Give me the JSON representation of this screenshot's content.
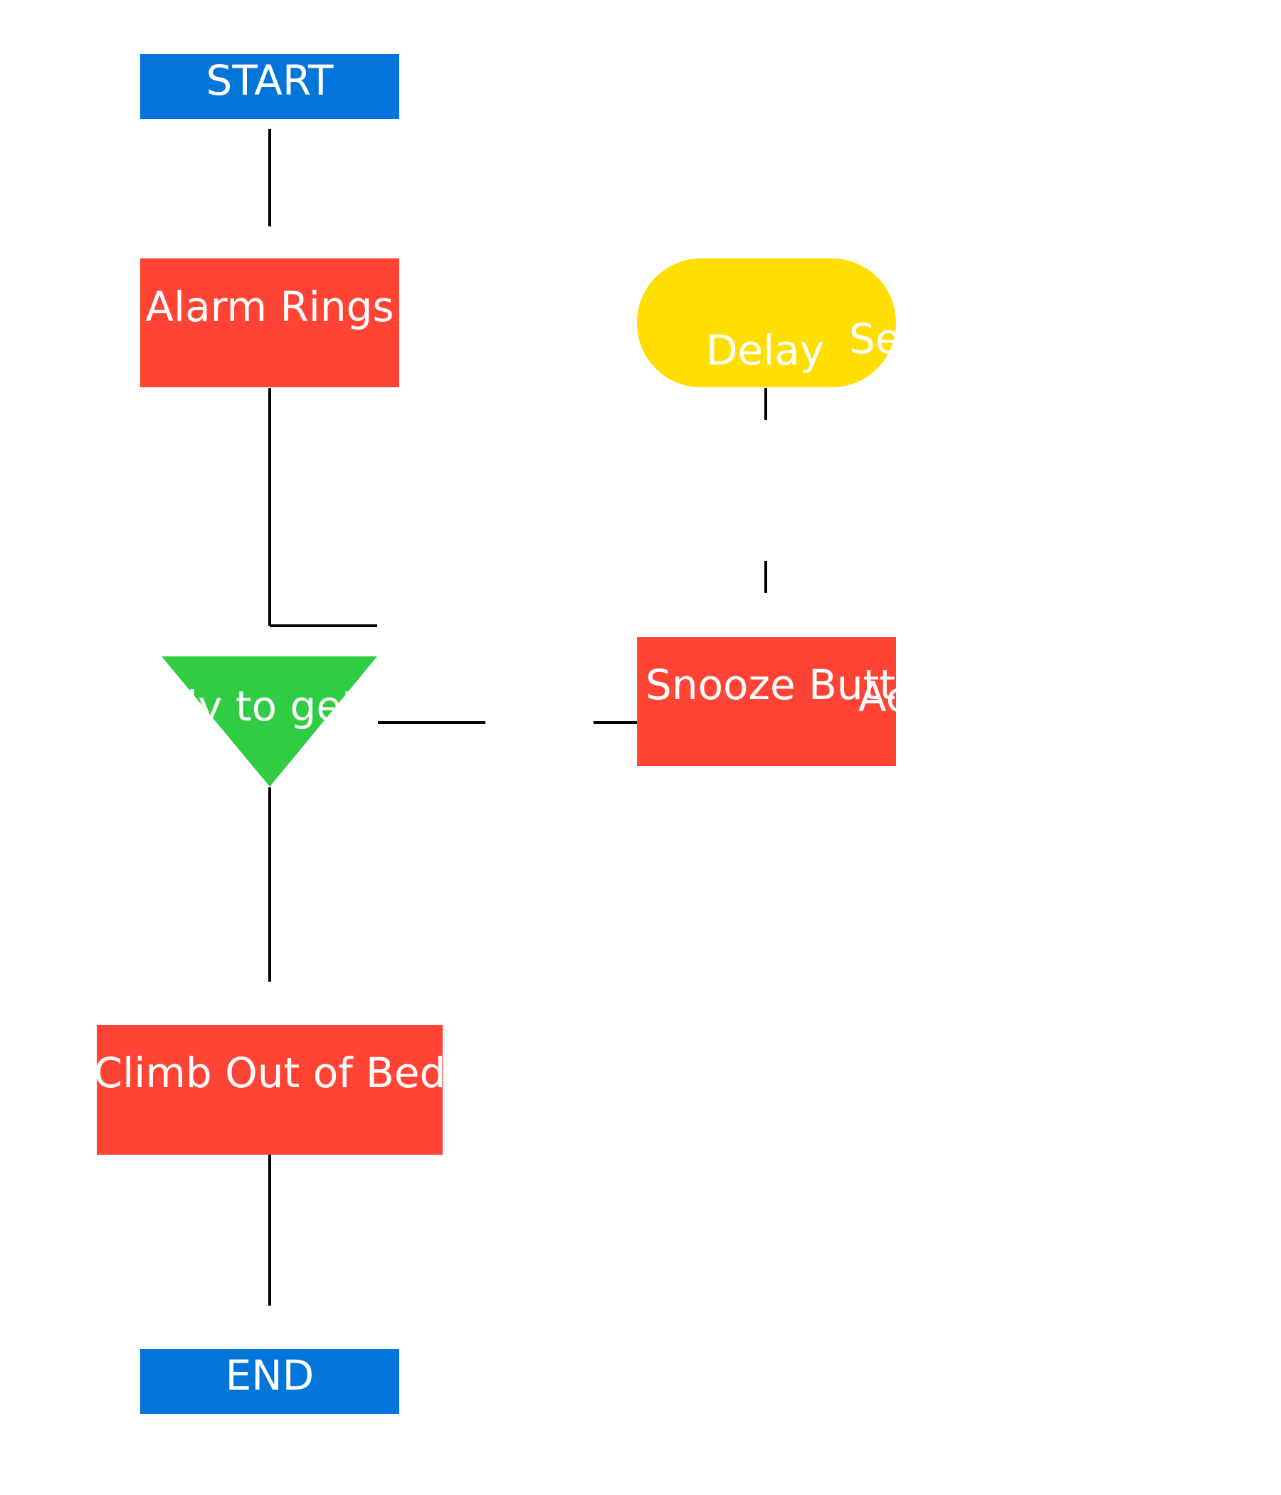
{
  "colors": {
    "terminal": "#0275DB",
    "process": "#FF4436",
    "decision": "#30CC42",
    "delay": "#FFDE00",
    "line": "#000000",
    "text": "#FFFFFF"
  },
  "nodes": {
    "start": {
      "label": "START",
      "shape": "rectangle"
    },
    "alarm": {
      "label": "Alarm Rings",
      "shape": "rectangle"
    },
    "ready": {
      "label": "Ready to get up?",
      "shape": "inverted-triangle"
    },
    "snooze": {
      "label": "Snooze Button",
      "shape": "rectangle"
    },
    "delay": {
      "label": "Delay",
      "shape": "stadium"
    },
    "climb": {
      "label": "Climb Out of Bed",
      "shape": "rectangle"
    },
    "end": {
      "label": "END",
      "shape": "rectangle"
    }
  },
  "edge_labels": {
    "snooze_to_delay": "Activated",
    "delay_tag": "Seconds"
  },
  "edges": [
    {
      "from": "start",
      "to": "alarm"
    },
    {
      "from": "alarm",
      "to": "ready"
    },
    {
      "from": "ready",
      "to": "snooze"
    },
    {
      "from": "snooze",
      "to": "delay"
    },
    {
      "from": "ready",
      "to": "climb"
    },
    {
      "from": "climb",
      "to": "end"
    }
  ]
}
